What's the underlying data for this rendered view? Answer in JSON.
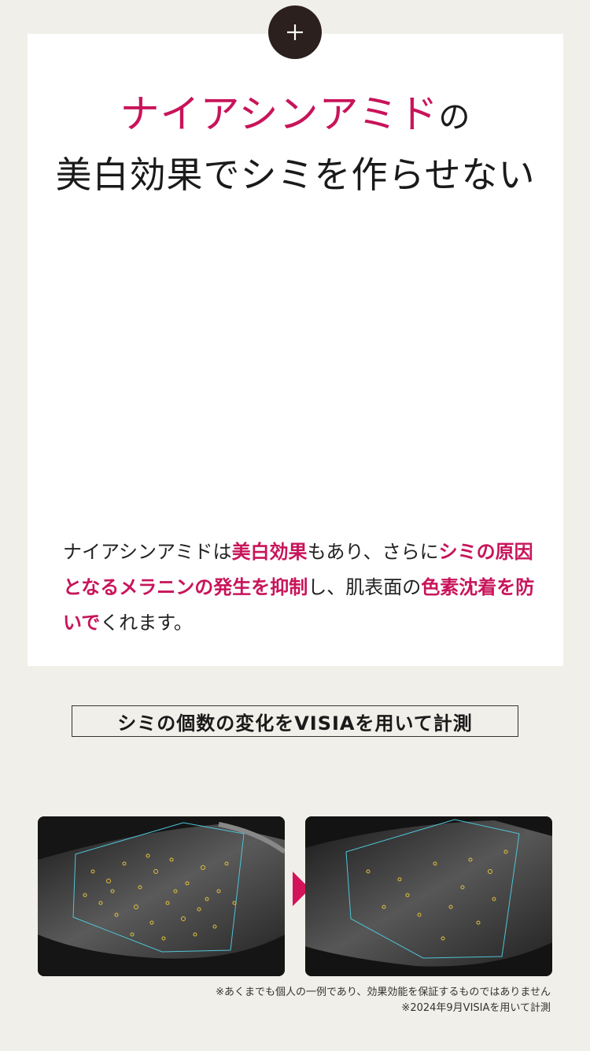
{
  "headline": {
    "accent": "ナイアシンアミド",
    "particle": "の",
    "line2": "美白効果でシミを作らせない"
  },
  "badge": {
    "icon": "plus-icon"
  },
  "paragraph": {
    "p1": "ナイアシンアミドは",
    "h1": "美白効果",
    "p2": "もあり、さらに",
    "h2": "シミの原因となるメラニンの発生を抑制",
    "p3": "し、肌表面の",
    "h3": "色素沈着を防いで",
    "p4": "くれます。"
  },
  "measure_label": "シミの個数の変化をVISIAを用いて計測",
  "images": {
    "before": "hand-skin-visia-before",
    "after": "hand-skin-visia-after",
    "arrow": "triangle-right-icon"
  },
  "notes": {
    "line1": "※あくまでも個人の一例であり、効果効能を保証するものではありません",
    "line2": "※2024年9月VISIAを用いて計測"
  },
  "colors": {
    "accent": "#c8145a",
    "badge": "#2b201d",
    "background": "#f1efe9"
  }
}
